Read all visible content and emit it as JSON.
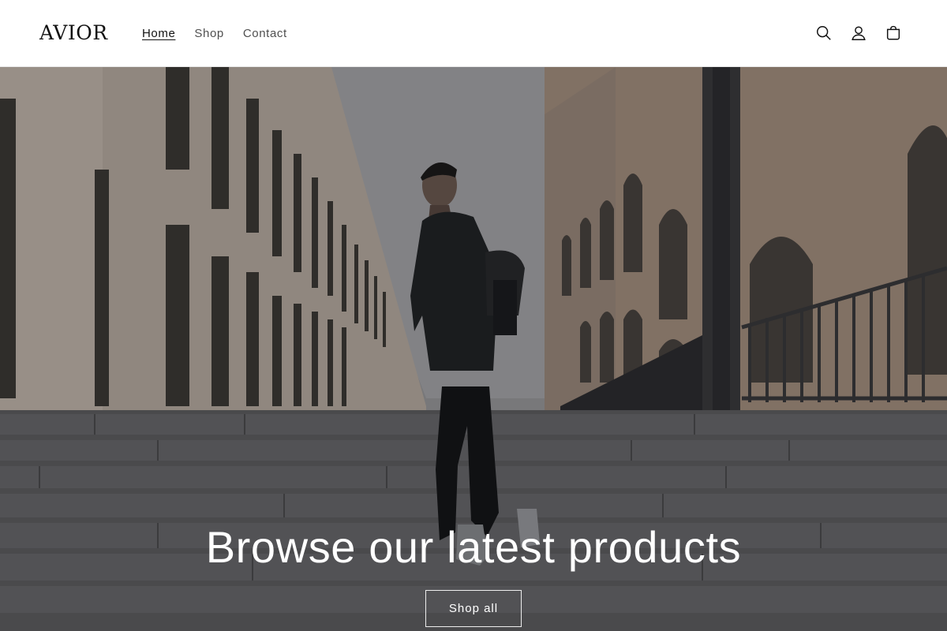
{
  "header": {
    "logo": "AVIOR",
    "nav": [
      {
        "label": "Home",
        "active": true
      },
      {
        "label": "Shop",
        "active": false
      },
      {
        "label": "Contact",
        "active": false
      }
    ],
    "icons": [
      "search-icon",
      "account-icon",
      "cart-icon"
    ]
  },
  "hero": {
    "title": "Browse our latest products",
    "button_label": "Shop all"
  },
  "colors": {
    "header_bg": "#ffffff",
    "text": "#121212",
    "hero_text": "#ffffff"
  }
}
